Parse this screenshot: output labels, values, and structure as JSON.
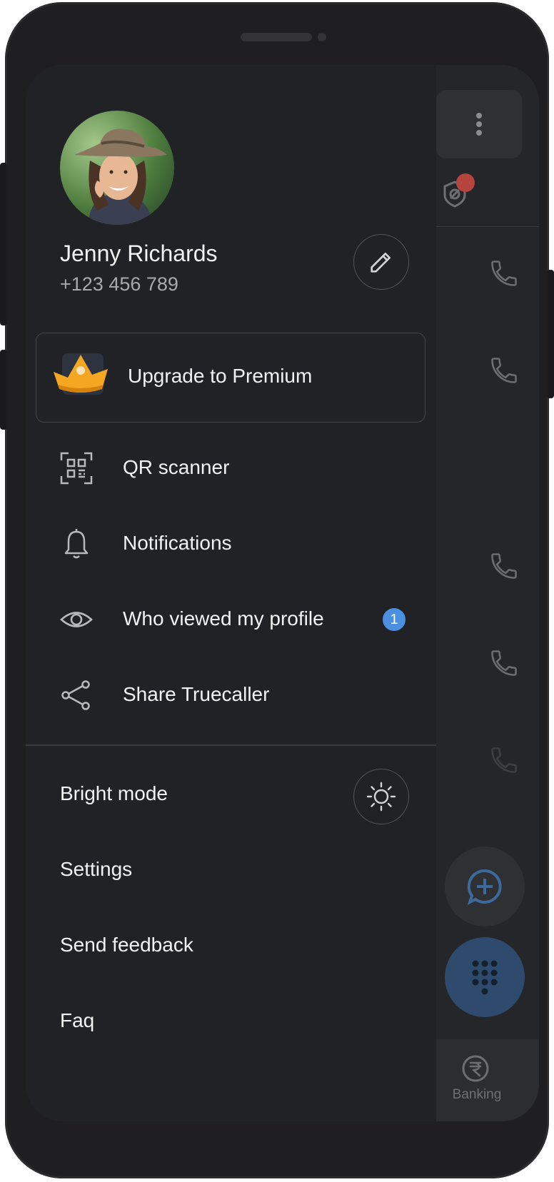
{
  "profile": {
    "name": "Jenny Richards",
    "phone": "+123 456 789"
  },
  "premium": {
    "label": "Upgrade to Premium"
  },
  "menu": [
    {
      "label": "QR scanner",
      "icon": "qr-code-icon"
    },
    {
      "label": "Notifications",
      "icon": "bell-icon"
    },
    {
      "label": "Who viewed my profile",
      "icon": "eye-icon",
      "badge": "1"
    },
    {
      "label": "Share Truecaller",
      "icon": "share-icon"
    }
  ],
  "settings": [
    {
      "label": "Bright mode"
    },
    {
      "label": "Settings"
    },
    {
      "label": "Send feedback"
    },
    {
      "label": "Faq"
    }
  ],
  "background_app": {
    "bottom_tab": {
      "label": "Banking",
      "icon": "rupee-icon"
    }
  },
  "colors": {
    "drawer_bg": "#212226",
    "text_primary": "#f2f2f2",
    "text_secondary": "#a8a9ad",
    "badge": "#4a8fe0",
    "crown": "#f5a623",
    "notification_dot": "#b5443f",
    "dial_fab": "#2e4a6c"
  }
}
